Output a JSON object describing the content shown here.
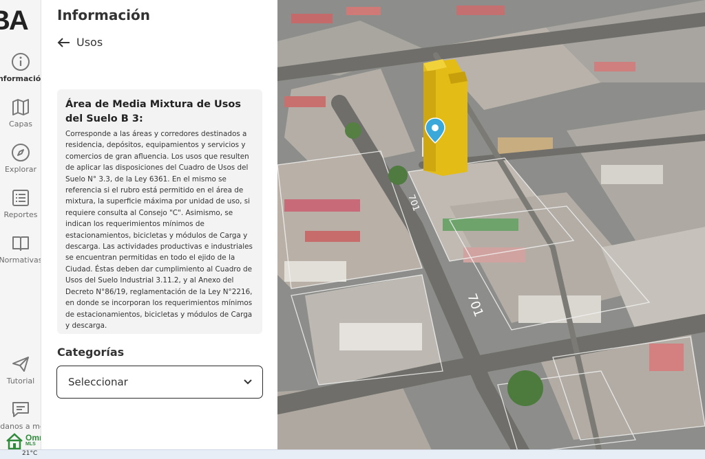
{
  "brand": {
    "logo_text": "BA",
    "omni_text": "Omni",
    "omni_sub": "MLS"
  },
  "rail": {
    "items": [
      {
        "id": "informacion",
        "label": "Información",
        "icon": "info-icon",
        "active": true
      },
      {
        "id": "capas",
        "label": "Capas",
        "icon": "map-icon",
        "active": false
      },
      {
        "id": "explorar",
        "label": "Explorar",
        "icon": "compass-icon",
        "active": false
      },
      {
        "id": "reportes",
        "label": "Reportes",
        "icon": "list-icon",
        "active": false
      },
      {
        "id": "normativas",
        "label": "Normativas",
        "icon": "book-icon",
        "active": false
      },
      {
        "id": "tutorial",
        "label": "Tutorial",
        "icon": "send-icon",
        "active": false
      },
      {
        "id": "ayudanos",
        "label": "Ayudanos a mejorar",
        "icon": "chat-icon",
        "active": false
      }
    ]
  },
  "panel": {
    "title": "Información",
    "back_label": "Usos",
    "card_title": "Área de Media Mixtura de Usos del Suelo B 3:",
    "card_body": "Corresponde a las áreas y corredores destinados a residencia, depósitos, equipamientos y servicios y comercios de gran afluencia. Los usos que resulten de aplicar las disposiciones del Cuadro de Usos del Suelo N° 3.3, de la Ley 6361. En el mismo se referencia si el rubro está permitido en el área de mixtura, la superficie máxima por unidad de uso, si requiere consulta al Consejo \"C\". Asimismo, se indican los requerimientos mínimos de estacionamientos, bicicletas y módulos de Carga y descarga. Las actividades productivas e industriales se encuentran permitidas en todo el ejido de la Ciudad. Éstas deben dar cumplimiento al Cuadro de Usos del Suelo Industrial 3.11.2, y al Anexo del Decreto N°86/19, reglamentación de la Ley N°2216, en donde se incorporan los requerimientos mínimos de estacionamientos, bicicletas y módulos de Carga y descarga.",
    "categories_title": "Categorías",
    "select_label": "Seleccionar"
  },
  "map": {
    "street_numbers": [
      "701",
      "701"
    ],
    "colors": {
      "building": "#e8c21a",
      "pin": "#3aa8d8"
    }
  },
  "taskbar": {
    "temperature": "21°C"
  }
}
